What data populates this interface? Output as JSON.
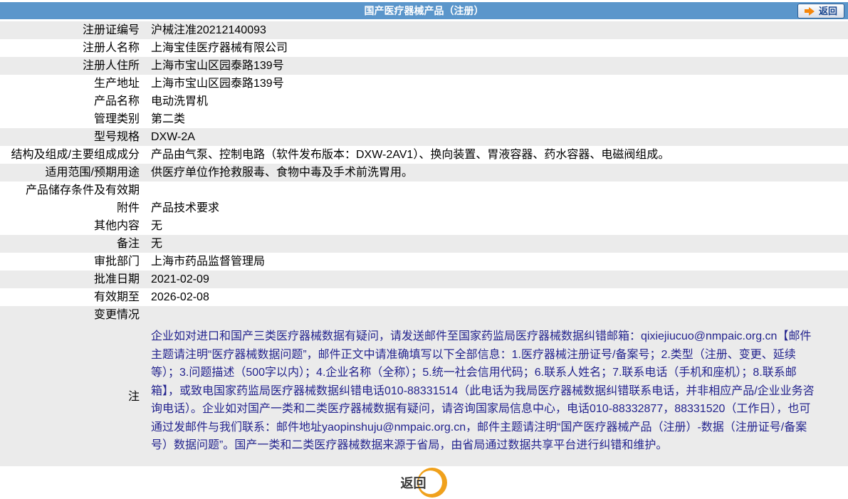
{
  "header": {
    "title": "国产医疗器械产品（注册）",
    "back_label": "返回"
  },
  "colors": {
    "header_bg": "#5B96CB",
    "shaded_row_bg": "#EBEBEB",
    "note_text": "#23238E",
    "accent_orange": "#F5860B",
    "crescent_orange": "#F0A11C",
    "back_button_text": "#17448E"
  },
  "rows": [
    {
      "label": "注册证编号",
      "value": "沪械注准20212140093",
      "shaded": true
    },
    {
      "label": "注册人名称",
      "value": "上海宝佳医疗器械有限公司",
      "shaded": false
    },
    {
      "label": "注册人住所",
      "value": "上海市宝山区园泰路139号",
      "shaded": true
    },
    {
      "label": "生产地址",
      "value": "上海市宝山区园泰路139号",
      "shaded": false
    },
    {
      "label": "产品名称",
      "value": "电动洗胃机",
      "shaded": false
    },
    {
      "label": "管理类别",
      "value": "第二类",
      "shaded": false
    },
    {
      "label": "型号规格",
      "value": "DXW-2A",
      "shaded": true
    },
    {
      "label": "结构及组成/主要组成成分",
      "value": "产品由气泵、控制电路（软件发布版本：DXW-2AV1）、换向装置、胃液容器、药水容器、电磁阀组成。",
      "shaded": false
    },
    {
      "label": "适用范围/预期用途",
      "value": "供医疗单位作抢救服毒、食物中毒及手术前洗胃用。",
      "shaded": true
    },
    {
      "label": "产品储存条件及有效期",
      "value": "",
      "shaded": false
    },
    {
      "label": "附件",
      "value": "产品技术要求",
      "shaded": false
    },
    {
      "label": "其他内容",
      "value": "无",
      "shaded": false
    },
    {
      "label": "备注",
      "value": "无",
      "shaded": true
    },
    {
      "label": "审批部门",
      "value": "上海市药品监督管理局",
      "shaded": false
    },
    {
      "label": "批准日期",
      "value": "2021-02-09",
      "shaded": true
    },
    {
      "label": "有效期至",
      "value": "2026-02-08",
      "shaded": false
    },
    {
      "label": "变更情况",
      "value": "",
      "shaded": true
    }
  ],
  "note": {
    "label": "注",
    "text": "企业如对进口和国产三类医疗器械数据有疑问，请发送邮件至国家药监局医疗器械数据纠错邮箱：qixiejiucuo@nmpaic.org.cn【邮件主题请注明“医疗器械数据问题”，邮件正文中请准确填写以下全部信息：1.医疗器械注册证号/备案号；2.类型（注册、变更、延续等）；3.问题描述（500字以内）；4.企业名称（全称）；5.统一社会信用代码；6.联系人姓名；7.联系电话（手机和座机）；8.联系邮箱】，或致电国家药监局医疗器械数据纠错电话010-88331514（此电话为我局医疗器械数据纠错联系电话，并非相应产品/企业业务咨询电话）。企业如对国产一类和二类医疗器械数据有疑问，请咨询国家局信息中心，电话010-88332877，88331520（工作日），也可通过发邮件与我们联系：邮件地址yaopinshuju@nmpaic.org.cn，邮件主题请注明“国产医疗器械产品（注册）-数据（注册证号/备案号）数据问题”。国产一类和二类医疗器械数据来源于省局，由省局通过数据共享平台进行纠错和维护。"
  },
  "footer": {
    "back_label": "返回"
  }
}
